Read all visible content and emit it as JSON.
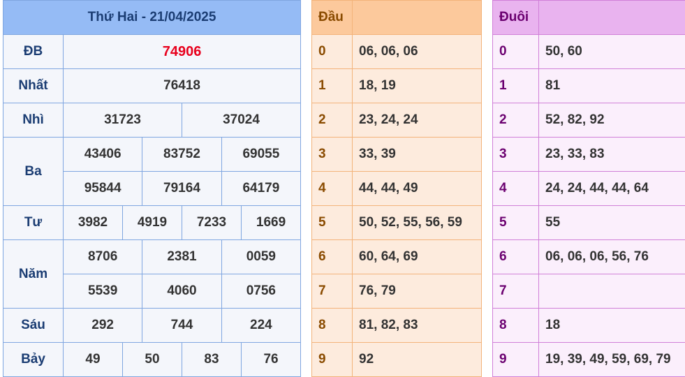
{
  "results": {
    "title": "Thứ Hai - 21/04/2025",
    "db": {
      "label": "ĐB",
      "value": "74906",
      "color": "#e8001c"
    },
    "nhat": {
      "label": "Nhất",
      "value": "76418"
    },
    "nhi": {
      "label": "Nhì",
      "values": [
        "31723",
        "37024"
      ]
    },
    "ba": {
      "label": "Ba",
      "values": [
        "43406",
        "83752",
        "69055",
        "95844",
        "79164",
        "64179"
      ]
    },
    "tu": {
      "label": "Tư",
      "values": [
        "3982",
        "4919",
        "7233",
        "1669"
      ]
    },
    "nam": {
      "label": "Năm",
      "values": [
        "8706",
        "2381",
        "0059",
        "5539",
        "4060",
        "0756"
      ]
    },
    "sau": {
      "label": "Sáu",
      "values": [
        "292",
        "744",
        "224"
      ]
    },
    "bay": {
      "label": "Bảy",
      "values": [
        "49",
        "50",
        "83",
        "76"
      ]
    }
  },
  "dau": {
    "header": "Đầu",
    "rows": [
      {
        "key": "0",
        "value": "06, 06, 06"
      },
      {
        "key": "1",
        "value": "18, 19"
      },
      {
        "key": "2",
        "value": "23, 24, 24"
      },
      {
        "key": "3",
        "value": "33, 39"
      },
      {
        "key": "4",
        "value": "44, 44, 49"
      },
      {
        "key": "5",
        "value": "50, 52, 55, 56, 59"
      },
      {
        "key": "6",
        "value": "60, 64, 69"
      },
      {
        "key": "7",
        "value": "76, 79"
      },
      {
        "key": "8",
        "value": "81, 82, 83"
      },
      {
        "key": "9",
        "value": "92"
      }
    ]
  },
  "duoi": {
    "header": "Đuôi",
    "rows": [
      {
        "key": "0",
        "value": "50, 60"
      },
      {
        "key": "1",
        "value": "81"
      },
      {
        "key": "2",
        "value": "52, 82, 92"
      },
      {
        "key": "3",
        "value": "23, 33, 83"
      },
      {
        "key": "4",
        "value": "24, 24, 44, 44, 64"
      },
      {
        "key": "5",
        "value": "55"
      },
      {
        "key": "6",
        "value": "06, 06, 06, 56, 76"
      },
      {
        "key": "7",
        "value": ""
      },
      {
        "key": "8",
        "value": "18"
      },
      {
        "key": "9",
        "value": "19, 39, 49, 59, 69, 79"
      }
    ]
  },
  "colors": {
    "results_header": "#95bbf5",
    "dau_header": "#fcc99c",
    "duoi_header": "#e9b3ef",
    "special_prize": "#e8001c"
  }
}
